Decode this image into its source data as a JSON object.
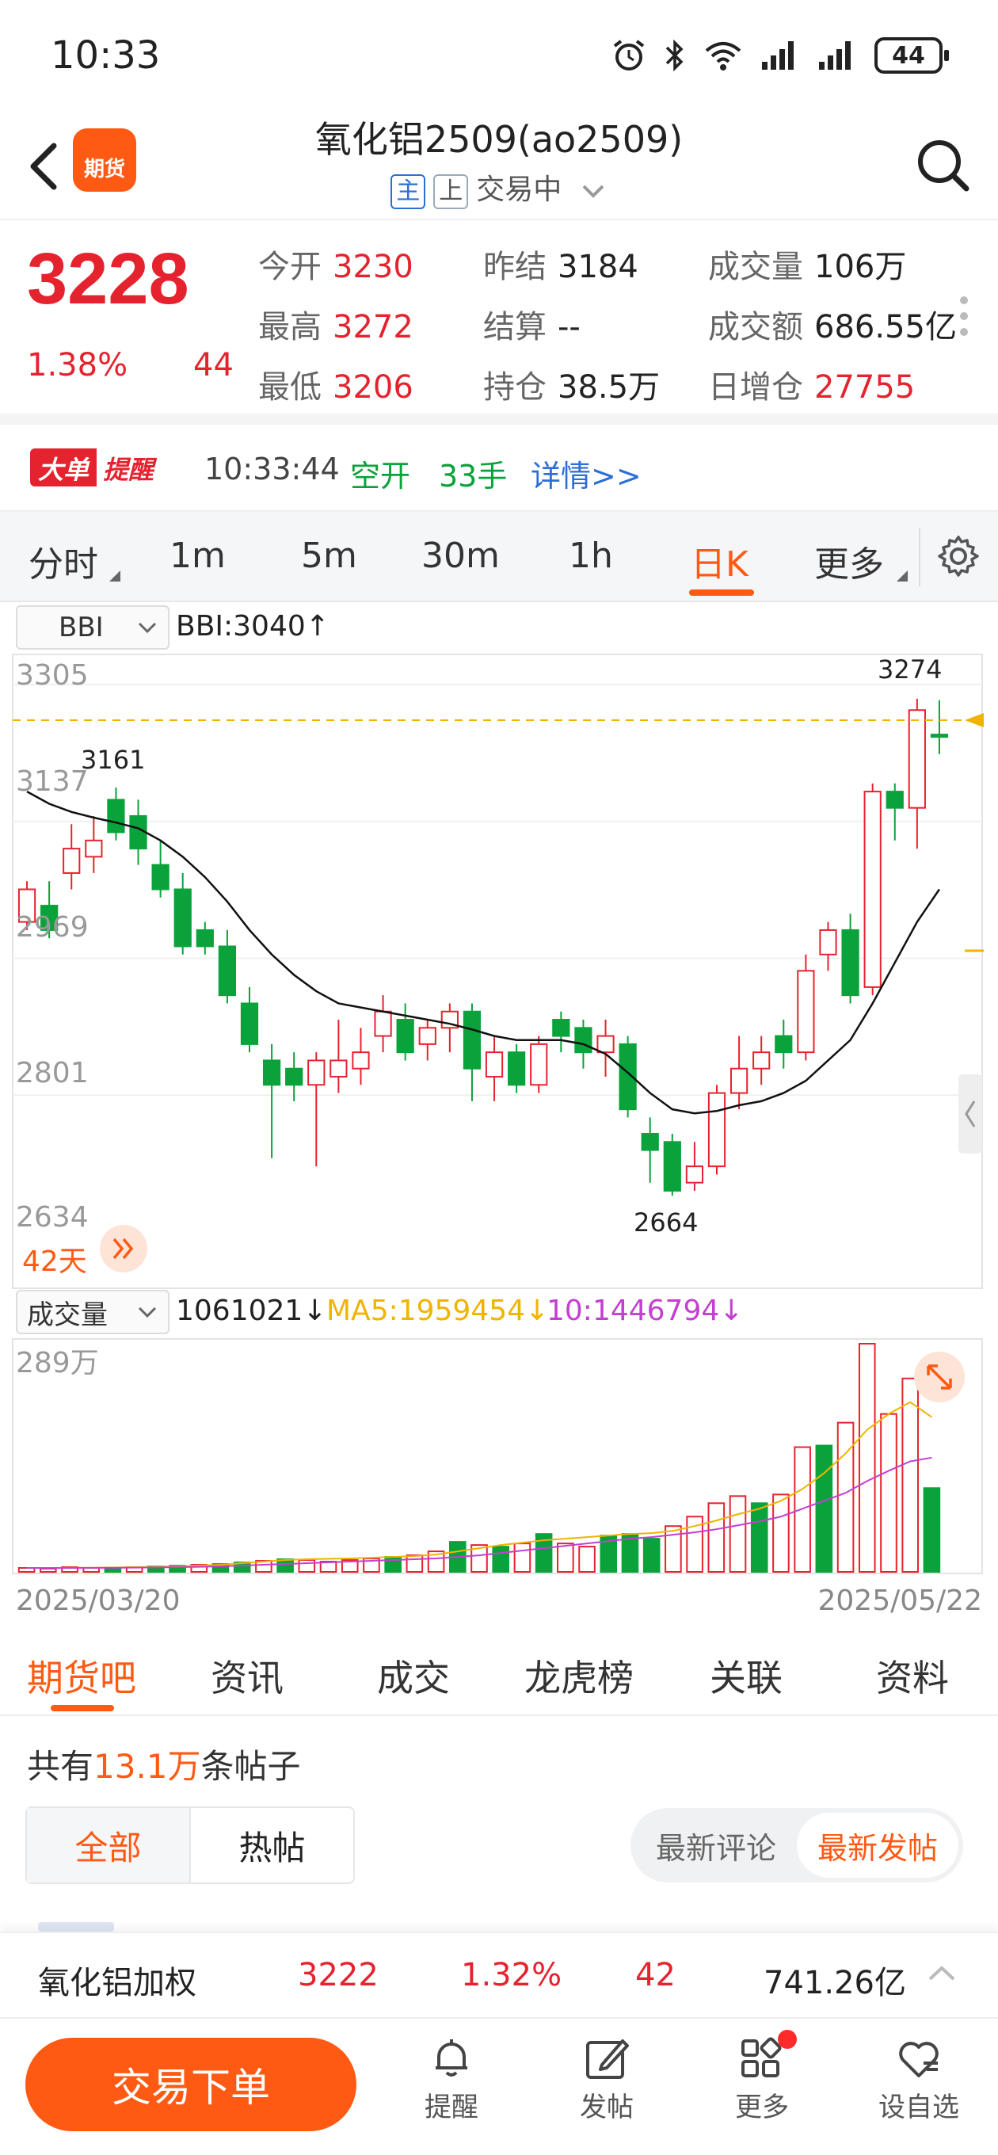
{
  "status": {
    "time": "10:33",
    "battery": "44"
  },
  "header": {
    "title": "氧化铝2509(ao2509)",
    "tag_main": "主",
    "tag_up": "上",
    "state": "交易中",
    "logo_text": "期货"
  },
  "quote": {
    "price": "3228",
    "pct": "1.38%",
    "change": "44",
    "open_label": "今开",
    "open": "3230",
    "prev_label": "昨结",
    "prev": "3184",
    "vol_label": "成交量",
    "vol": "106万",
    "high_label": "最高",
    "high": "3272",
    "settle_label": "结算",
    "settle": "--",
    "amount_label": "成交额",
    "amount": "686.55亿",
    "low_label": "最低",
    "low": "3206",
    "hold_label": "持仓",
    "hold": "38.5万",
    "inc_label": "日增仓",
    "inc": "27755"
  },
  "big_order": {
    "badge_a": "大单",
    "badge_b": "提醒",
    "time": "10:33:44",
    "type": "空开",
    "lots": "33手",
    "detail": "详情>>"
  },
  "periods": [
    "分时",
    "1m",
    "5m",
    "30m",
    "1h",
    "日K",
    "更多"
  ],
  "indicator": {
    "name": "BBI",
    "value": "BBI:3040↑"
  },
  "kline_labels": {
    "y_ticks": [
      "3305",
      "3137",
      "2969",
      "2801",
      "2634"
    ],
    "high_mark": "3274",
    "left_mark": "3161",
    "low_mark": "2664",
    "days": "42天"
  },
  "volume": {
    "selector": "成交量",
    "value": "1061021↓",
    "ma5": "MA5:1959454↓",
    "ma10": "10:1446794↓",
    "ymax": "289万",
    "date_start": "2025/03/20",
    "date_end": "2025/05/22"
  },
  "colors": {
    "up": "#e5232f",
    "down": "#0aa23a",
    "accent": "#ff5a14",
    "bbi": "#111111",
    "ma5": "#f0b400",
    "ma10": "#c33fd0"
  },
  "chart_data": {
    "type": "candlestick",
    "ylim": [
      2634,
      3305
    ],
    "candles": [
      [
        3000,
        3040,
        2990,
        3050
      ],
      [
        3020,
        2990,
        2980,
        3050
      ],
      [
        3060,
        3090,
        3040,
        3120
      ],
      [
        3080,
        3100,
        3060,
        3130
      ],
      [
        3150,
        3110,
        3100,
        3165
      ],
      [
        3130,
        3090,
        3070,
        3150
      ],
      [
        3070,
        3040,
        3030,
        3100
      ],
      [
        3040,
        2970,
        2960,
        3060
      ],
      [
        2990,
        2970,
        2960,
        3000
      ],
      [
        2970,
        2910,
        2900,
        2990
      ],
      [
        2900,
        2850,
        2840,
        2920
      ],
      [
        2830,
        2800,
        2710,
        2850
      ],
      [
        2820,
        2800,
        2780,
        2840
      ],
      [
        2800,
        2830,
        2700,
        2840
      ],
      [
        2810,
        2830,
        2790,
        2880
      ],
      [
        2820,
        2840,
        2800,
        2870
      ],
      [
        2860,
        2890,
        2840,
        2910
      ],
      [
        2880,
        2840,
        2830,
        2900
      ],
      [
        2850,
        2870,
        2830,
        2880
      ],
      [
        2870,
        2890,
        2840,
        2900
      ],
      [
        2890,
        2820,
        2780,
        2900
      ],
      [
        2810,
        2840,
        2780,
        2860
      ],
      [
        2840,
        2800,
        2790,
        2850
      ],
      [
        2800,
        2850,
        2790,
        2860
      ],
      [
        2880,
        2860,
        2840,
        2890
      ],
      [
        2870,
        2840,
        2820,
        2880
      ],
      [
        2840,
        2860,
        2810,
        2880
      ],
      [
        2850,
        2770,
        2760,
        2860
      ],
      [
        2740,
        2720,
        2680,
        2760
      ],
      [
        2730,
        2670,
        2664,
        2740
      ],
      [
        2680,
        2700,
        2670,
        2730
      ],
      [
        2700,
        2790,
        2690,
        2800
      ],
      [
        2790,
        2820,
        2770,
        2860
      ],
      [
        2820,
        2840,
        2800,
        2860
      ],
      [
        2860,
        2840,
        2820,
        2880
      ],
      [
        2840,
        2940,
        2830,
        2960
      ],
      [
        2960,
        2990,
        2940,
        3000
      ],
      [
        2990,
        2910,
        2900,
        3010
      ],
      [
        2920,
        3160,
        2910,
        3170
      ],
      [
        3160,
        3140,
        3100,
        3170
      ],
      [
        3140,
        3260,
        3090,
        3274
      ],
      [
        3230,
        3228,
        3206,
        3272
      ]
    ],
    "bbi": [
      3160,
      3145,
      3135,
      3128,
      3122,
      3115,
      3100,
      3080,
      3055,
      3025,
      2990,
      2960,
      2935,
      2915,
      2900,
      2895,
      2890,
      2885,
      2880,
      2875,
      2868,
      2860,
      2855,
      2855,
      2855,
      2850,
      2838,
      2815,
      2790,
      2770,
      2765,
      2768,
      2775,
      2780,
      2790,
      2805,
      2830,
      2855,
      2900,
      2950,
      3000,
      3040
    ],
    "volumes": [
      50000,
      40000,
      60000,
      50000,
      55000,
      60000,
      70000,
      80000,
      90000,
      100000,
      120000,
      140000,
      160000,
      150000,
      130000,
      150000,
      170000,
      190000,
      210000,
      260000,
      380000,
      340000,
      320000,
      360000,
      480000,
      360000,
      320000,
      460000,
      480000,
      420000,
      580000,
      700000,
      870000,
      960000,
      870000,
      980000,
      1580000,
      1600000,
      1890000,
      2890000,
      2000000,
      2450000,
      1061021
    ],
    "volume_up": [
      true,
      true,
      true,
      true,
      false,
      true,
      false,
      false,
      true,
      false,
      false,
      true,
      false,
      true,
      true,
      true,
      true,
      false,
      true,
      true,
      false,
      true,
      false,
      true,
      false,
      true,
      true,
      false,
      false,
      false,
      true,
      true,
      true,
      true,
      false,
      true,
      true,
      false,
      true,
      true,
      true,
      true,
      false
    ],
    "ma5_vol": [
      50000,
      48000,
      52000,
      53000,
      55000,
      60000,
      65000,
      70000,
      80000,
      90000,
      110000,
      130000,
      150000,
      160000,
      165000,
      170000,
      180000,
      190000,
      200000,
      220000,
      260000,
      300000,
      340000,
      370000,
      400000,
      420000,
      440000,
      460000,
      480000,
      490000,
      520000,
      580000,
      650000,
      730000,
      800000,
      900000,
      1050000,
      1250000,
      1500000,
      1800000,
      2000000,
      2150000,
      1959454
    ],
    "ma10_vol": [
      50000,
      49000,
      50000,
      51000,
      52000,
      54000,
      57000,
      60000,
      64000,
      70000,
      80000,
      90000,
      100000,
      110000,
      120000,
      130000,
      140000,
      150000,
      160000,
      170000,
      190000,
      210000,
      240000,
      270000,
      300000,
      330000,
      360000,
      390000,
      420000,
      440000,
      470000,
      500000,
      540000,
      590000,
      640000,
      700000,
      800000,
      900000,
      1000000,
      1150000,
      1280000,
      1400000,
      1446794
    ]
  },
  "bottom_tabs": [
    "期货吧",
    "资讯",
    "成交",
    "龙虎榜",
    "关联",
    "资料"
  ],
  "posts": {
    "prefix": "共有",
    "count": "13.1万",
    "suffix": "条帖子"
  },
  "filters": {
    "all": "全部",
    "hot": "热帖",
    "latest_comment": "最新评论",
    "latest_post": "最新发帖"
  },
  "weighted": {
    "name": "氧化铝加权",
    "price": "3222",
    "pct": "1.32%",
    "chg": "42",
    "amount": "741.26亿"
  },
  "bottom_bar": {
    "trade": "交易下单",
    "nav": [
      "提醒",
      "发帖",
      "更多",
      "设自选"
    ]
  }
}
